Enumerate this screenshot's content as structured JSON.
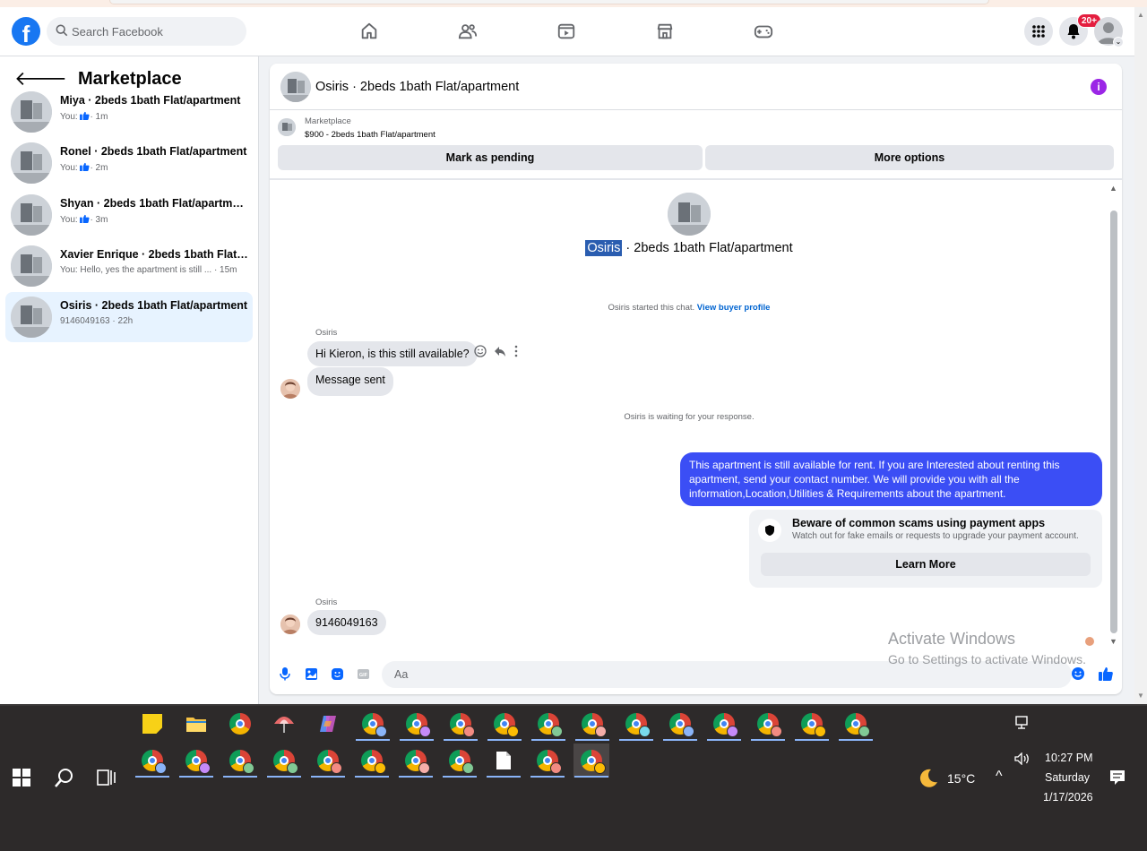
{
  "header": {
    "search_placeholder": "Search Facebook",
    "nav_icons": [
      "home-icon",
      "friends-icon",
      "video-icon",
      "marketplace-icon",
      "gaming-icon"
    ],
    "notifications_badge": "20+",
    "brand_color": "#1877f2"
  },
  "sidebar": {
    "title": "Marketplace",
    "conversations": [
      {
        "name": "Miya · 2beds 1bath Flat/apartment",
        "prefix": "You:",
        "time": "· 1m",
        "has_like": true,
        "preview": ""
      },
      {
        "name": "Ronel · 2beds 1bath Flat/apartment",
        "prefix": "You:",
        "time": "· 2m",
        "has_like": true,
        "preview": ""
      },
      {
        "name": "Shyan · 2beds 1bath Flat/apartment",
        "prefix": "You:",
        "time": "· 3m",
        "has_like": true,
        "preview": ""
      },
      {
        "name": "Xavier Enrique · 2beds 1bath Flat/a...",
        "prefix": "You: Hello, yes the apartment is still ...",
        "time": "· 15m",
        "has_like": false,
        "preview": ""
      },
      {
        "name": "Osiris · 2beds 1bath Flat/apartment",
        "prefix": "9146049163",
        "time": "· 22h",
        "has_like": false,
        "preview": ""
      }
    ]
  },
  "chat": {
    "header_title": "Osiris · 2beds 1bath Flat/apartment",
    "listing_source": "Marketplace",
    "listing_price": "$900 - 2beds 1bath Flat/apartment",
    "mark_pending_label": "Mark as pending",
    "more_options_label": "More options",
    "intro_name": "Osiris",
    "intro_rest": " · 2beds 1bath Flat/apartment",
    "started_text": "Osiris started this chat.",
    "view_profile_label": "View buyer profile",
    "sender_name": "Osiris",
    "msg1": "Hi Kieron, is this still available?",
    "msg2": "Message sent",
    "waiting_text": "Osiris is waiting for your response.",
    "outgoing": "This apartment is still available for rent. If you are Interested about renting this apartment, send your contact number. We will provide you with all the information,Location,Utilities & Requirements about the apartment.",
    "scam_title": "Beware of common scams using payment apps",
    "scam_desc": "Watch out for fake emails or requests to upgrade your payment account.",
    "learn_more_label": "Learn More",
    "sender_name2": "Osiris",
    "msg3": "9146049163",
    "composer_placeholder": "Aa",
    "outgoing_color": "#3b4ef5"
  },
  "watermark": {
    "line1": "Activate Windows",
    "line2": "Go to Settings to activate Windows."
  },
  "taskbar": {
    "weather": "15°C",
    "time": "10:27 PM",
    "day": "Saturday",
    "date": "1/17/2026"
  }
}
